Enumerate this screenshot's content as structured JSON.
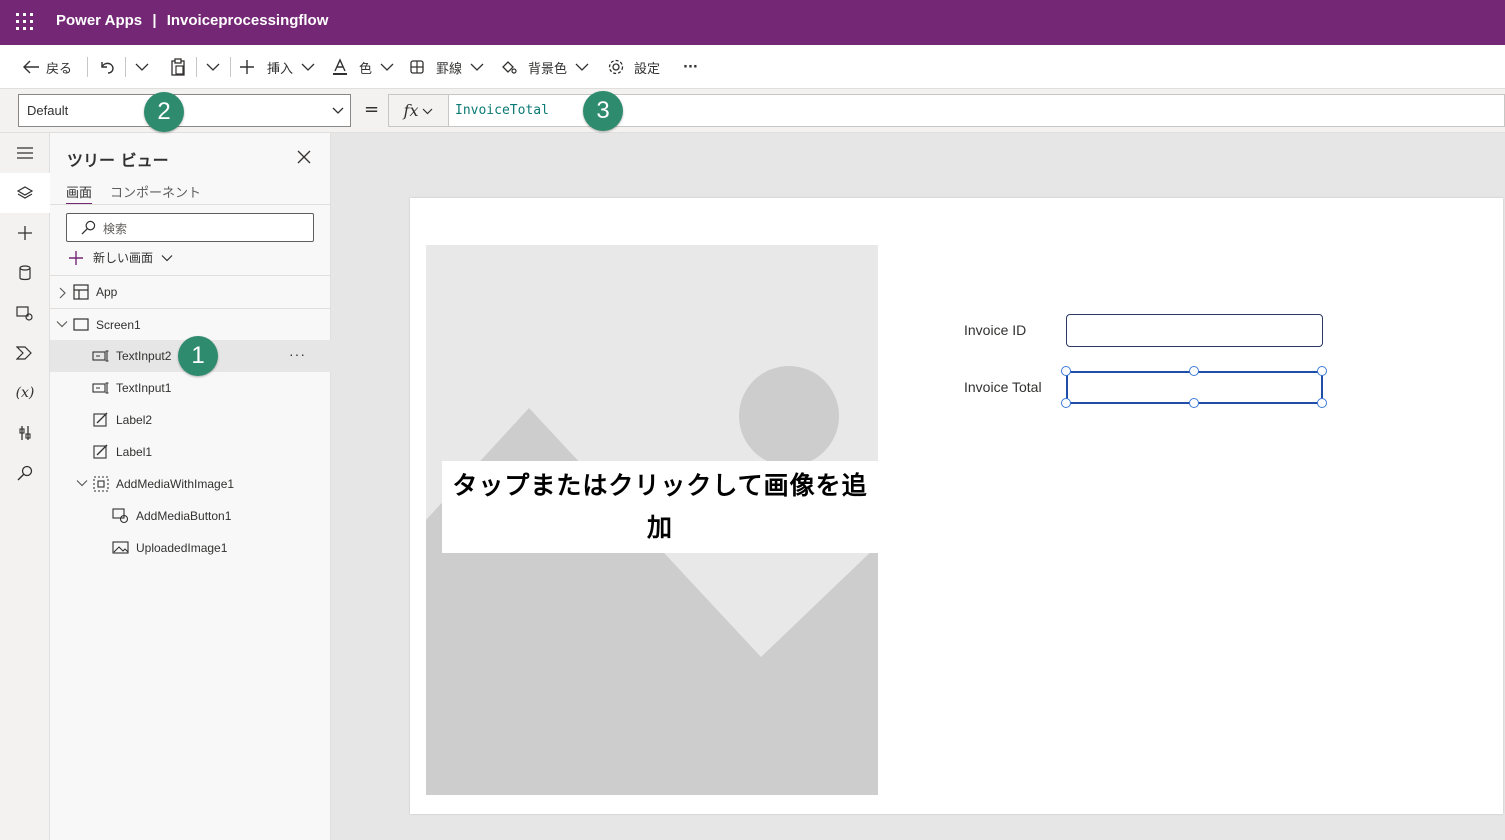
{
  "header": {
    "app_name": "Power Apps",
    "separator": "|",
    "app_title": "Invoiceprocessingflow"
  },
  "toolbar": {
    "back_label": "戻る",
    "insert_label": "挿入",
    "color_label": "色",
    "border_label": "罫線",
    "fill_label": "背景色",
    "settings_label": "設定",
    "more_label": "···"
  },
  "formula_bar": {
    "property_value": "Default",
    "equals": "=",
    "fx_label": "fx",
    "formula": "InvoiceTotal"
  },
  "badges": {
    "one": "1",
    "two": "2",
    "three": "3"
  },
  "tree_view": {
    "title": "ツリー ビュー",
    "tabs": [
      "画面",
      "コンポーネント"
    ],
    "search_placeholder": "検索",
    "new_screen_label": "新しい画面",
    "items": [
      {
        "label": "App",
        "icon": "app-icon"
      },
      {
        "label": "Screen1",
        "icon": "screen-icon"
      },
      {
        "label": "TextInput2",
        "icon": "text-input-icon",
        "selected": true
      },
      {
        "label": "TextInput1",
        "icon": "text-input-icon"
      },
      {
        "label": "Label2",
        "icon": "label-icon"
      },
      {
        "label": "Label1",
        "icon": "label-icon"
      },
      {
        "label": "AddMediaWithImage1",
        "icon": "media-group-icon"
      },
      {
        "label": "AddMediaButton1",
        "icon": "add-media-icon"
      },
      {
        "label": "UploadedImage1",
        "icon": "image-icon"
      }
    ],
    "row_more": "···"
  },
  "canvas": {
    "add_media_text": "タップまたはクリックして画像を追加",
    "invoice_id_label": "Invoice ID",
    "invoice_total_label": "Invoice Total",
    "invoice_id_value": "",
    "invoice_total_value": ""
  },
  "colors": {
    "brand": "#742774",
    "badge": "#2e8b6d",
    "formula_text": "#0b7a75",
    "selection": "#1f4ea8"
  }
}
